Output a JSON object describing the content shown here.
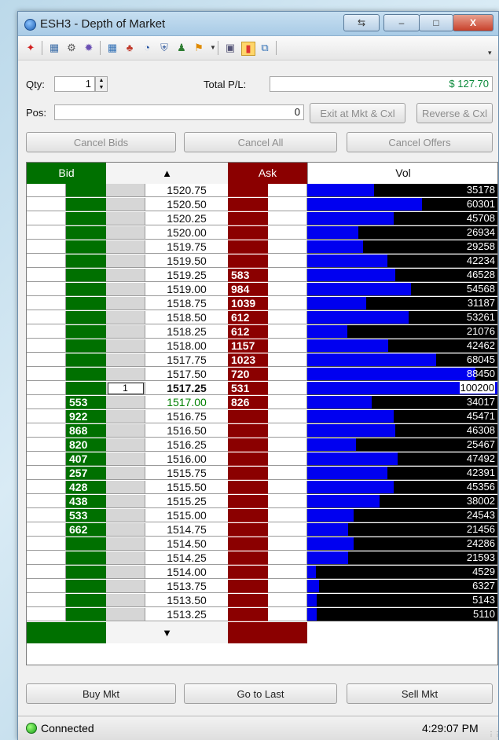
{
  "window": {
    "title": "ESH3 - Depth of Market",
    "caption_buttons": {
      "minimize": "–",
      "maximize": "□",
      "close": "X",
      "sync": "⇆"
    }
  },
  "toolbar": {
    "icons": [
      "pin-icon",
      "table-icon",
      "gear-icon",
      "orbit-icon",
      "settings-icon",
      "color-icon",
      "clock-icon",
      "shield-icon",
      "person-icon",
      "flag-icon",
      "image-icon",
      "palette-icon",
      "export-icon"
    ],
    "overflow": "▾"
  },
  "order_entry": {
    "qty_label": "Qty:",
    "qty_value": "1",
    "pnl_label": "Total P/L:",
    "pnl_value": "$ 127.70",
    "pos_label": "Pos:",
    "pos_value": "0",
    "exit_button": "Exit at Mkt & Cxl",
    "reverse_button": "Reverse & Cxl",
    "cancel_bids": "Cancel Bids",
    "cancel_all": "Cancel All",
    "cancel_offers": "Cancel Offers"
  },
  "ladder": {
    "headers": {
      "bid": "Bid",
      "scroll_up": "▲",
      "ask": "Ask",
      "vol": "Vol",
      "scroll_down": "▼"
    },
    "max_volume": 100200,
    "last_price": "1517.25",
    "rows": [
      {
        "price": "1520.75",
        "bid": "",
        "ask": "",
        "vol": "35178",
        "pos": ""
      },
      {
        "price": "1520.50",
        "bid": "",
        "ask": "",
        "vol": "60301",
        "pos": ""
      },
      {
        "price": "1520.25",
        "bid": "",
        "ask": "",
        "vol": "45708",
        "pos": ""
      },
      {
        "price": "1520.00",
        "bid": "",
        "ask": "",
        "vol": "26934",
        "pos": ""
      },
      {
        "price": "1519.75",
        "bid": "",
        "ask": "",
        "vol": "29258",
        "pos": ""
      },
      {
        "price": "1519.50",
        "bid": "",
        "ask": "",
        "vol": "42234",
        "pos": ""
      },
      {
        "price": "1519.25",
        "bid": "",
        "ask": "583",
        "vol": "46528",
        "pos": ""
      },
      {
        "price": "1519.00",
        "bid": "",
        "ask": "984",
        "vol": "54568",
        "pos": ""
      },
      {
        "price": "1518.75",
        "bid": "",
        "ask": "1039",
        "vol": "31187",
        "pos": ""
      },
      {
        "price": "1518.50",
        "bid": "",
        "ask": "612",
        "vol": "53261",
        "pos": ""
      },
      {
        "price": "1518.25",
        "bid": "",
        "ask": "612",
        "vol": "21076",
        "pos": ""
      },
      {
        "price": "1518.00",
        "bid": "",
        "ask": "1157",
        "vol": "42462",
        "pos": ""
      },
      {
        "price": "1517.75",
        "bid": "",
        "ask": "1023",
        "vol": "68045",
        "pos": ""
      },
      {
        "price": "1517.50",
        "bid": "",
        "ask": "720",
        "vol": "88450",
        "pos": ""
      },
      {
        "price": "1517.25",
        "bid": "",
        "ask": "531",
        "vol": "100200",
        "pos": "1"
      },
      {
        "price": "1517.00",
        "bid": "553",
        "ask": "826",
        "vol": "34017",
        "pos": ""
      },
      {
        "price": "1516.75",
        "bid": "922",
        "ask": "",
        "vol": "45471",
        "pos": ""
      },
      {
        "price": "1516.50",
        "bid": "868",
        "ask": "",
        "vol": "46308",
        "pos": ""
      },
      {
        "price": "1516.25",
        "bid": "820",
        "ask": "",
        "vol": "25467",
        "pos": ""
      },
      {
        "price": "1516.00",
        "bid": "407",
        "ask": "",
        "vol": "47492",
        "pos": ""
      },
      {
        "price": "1515.75",
        "bid": "257",
        "ask": "",
        "vol": "42391",
        "pos": ""
      },
      {
        "price": "1515.50",
        "bid": "428",
        "ask": "",
        "vol": "45356",
        "pos": ""
      },
      {
        "price": "1515.25",
        "bid": "438",
        "ask": "",
        "vol": "38002",
        "pos": ""
      },
      {
        "price": "1515.00",
        "bid": "533",
        "ask": "",
        "vol": "24543",
        "pos": ""
      },
      {
        "price": "1514.75",
        "bid": "662",
        "ask": "",
        "vol": "21456",
        "pos": ""
      },
      {
        "price": "1514.50",
        "bid": "",
        "ask": "",
        "vol": "24286",
        "pos": ""
      },
      {
        "price": "1514.25",
        "bid": "",
        "ask": "",
        "vol": "21593",
        "pos": ""
      },
      {
        "price": "1514.00",
        "bid": "",
        "ask": "",
        "vol": "4529",
        "pos": ""
      },
      {
        "price": "1513.75",
        "bid": "",
        "ask": "",
        "vol": "6327",
        "pos": ""
      },
      {
        "price": "1513.50",
        "bid": "",
        "ask": "",
        "vol": "5143",
        "pos": ""
      },
      {
        "price": "1513.25",
        "bid": "",
        "ask": "",
        "vol": "5110",
        "pos": ""
      }
    ]
  },
  "bottom_buttons": {
    "buy": "Buy Mkt",
    "goto": "Go to Last",
    "sell": "Sell Mkt"
  },
  "status": {
    "connection": "Connected",
    "time": "4:29:07 PM"
  },
  "colors": {
    "bid": "#007000",
    "ask": "#8b0000",
    "volume_bar": "#0000f0",
    "pnl": "#0a8a3a",
    "bid_price_text": "#008000"
  }
}
